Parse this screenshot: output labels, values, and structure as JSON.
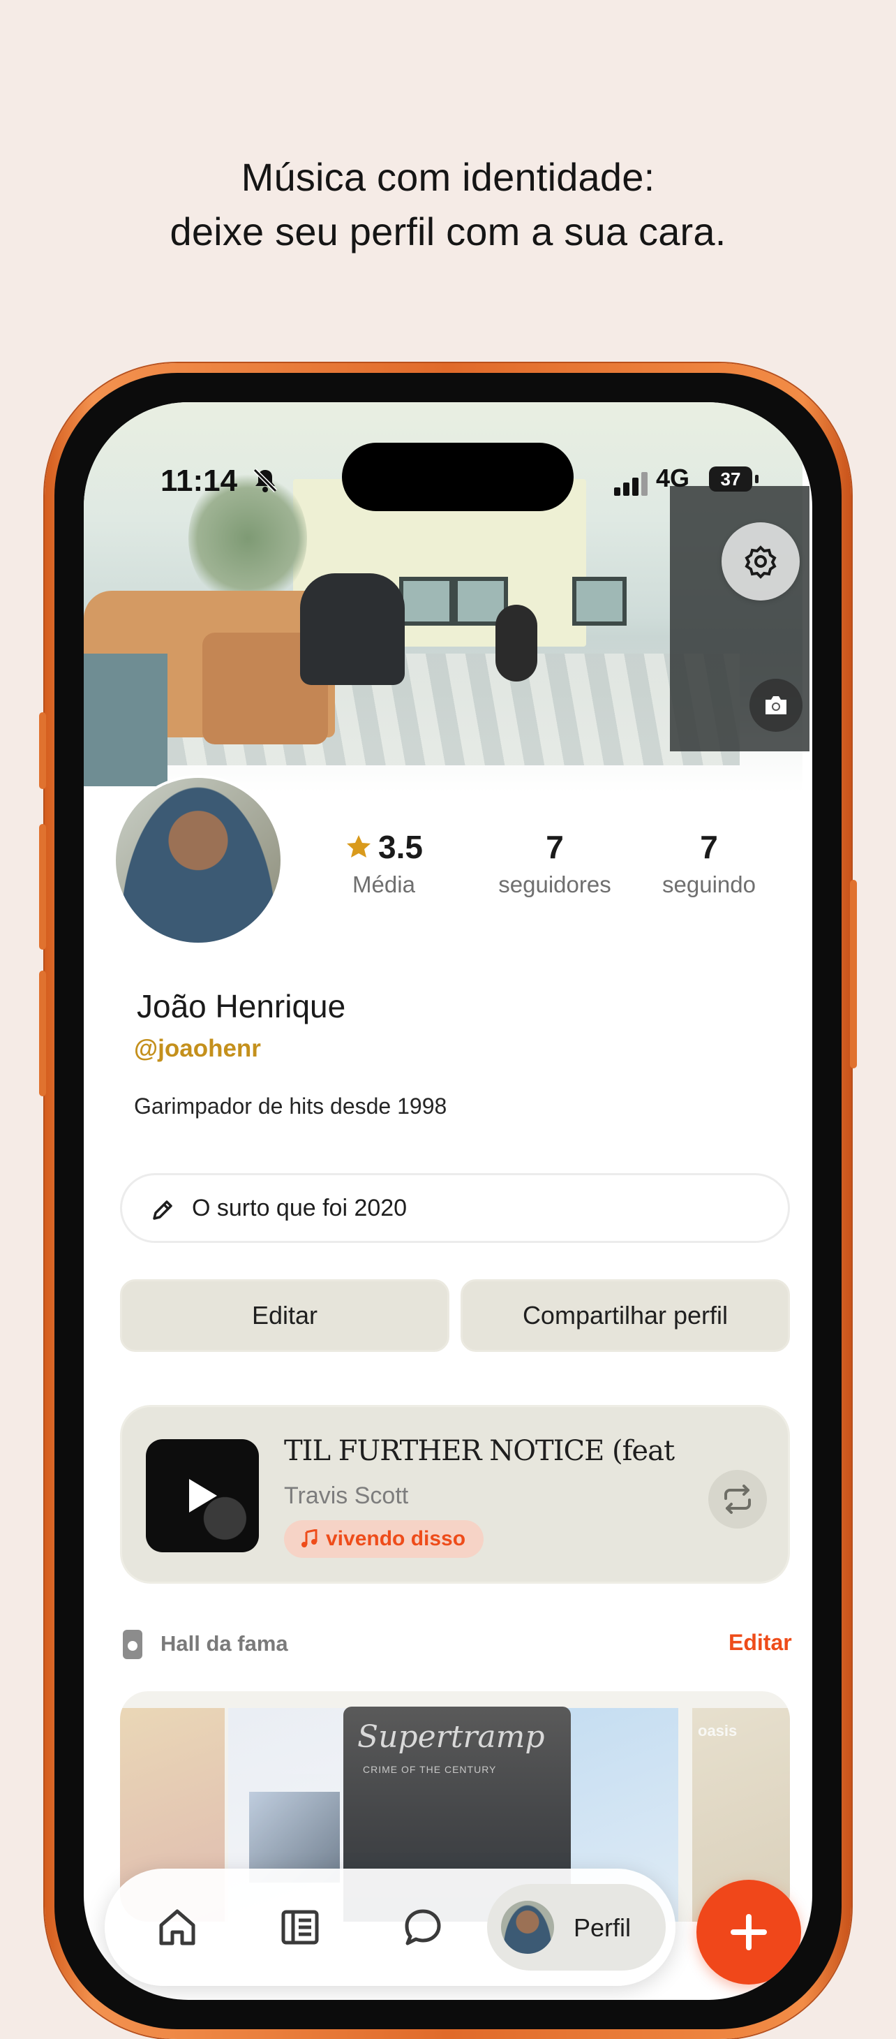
{
  "headline": {
    "line1": "Música com identidade:",
    "line2": "deixe seu perfil com a sua cara."
  },
  "status_bar": {
    "time": "11:14",
    "network": "4G",
    "battery": "37"
  },
  "profile": {
    "rating": "3.5",
    "rating_label": "Média",
    "followers": "7",
    "followers_label": "seguidores",
    "following": "7",
    "following_label": "seguindo",
    "name": "João Henrique",
    "handle": "@joaohenr",
    "bio": "Garimpador de hits desde 1998",
    "status_text": "O surto que foi 2020"
  },
  "actions": {
    "edit_label": "Editar",
    "share_label": "Compartilhar perfil"
  },
  "now_playing": {
    "title": "TIL FURTHER NOTICE (feat. Ja...",
    "artist": "Travis Scott",
    "badge": "vivendo disso"
  },
  "hall_of_fame": {
    "label": "Hall da fama",
    "edit_label": "Editar",
    "albums": [
      {
        "brand": "Supertramp",
        "subtitle": "CRIME OF THE CENTURY"
      },
      {
        "brand": "oasis"
      }
    ]
  },
  "tabbar": {
    "profile_label": "Perfil"
  },
  "colors": {
    "accent": "#ee4c1a",
    "handle": "#c4901c",
    "star": "#d99a1c",
    "background": "#f5ebe6",
    "phone_frame": "#e06a2a"
  },
  "icons": [
    "bell-slash-icon",
    "signal-icon",
    "gear-icon",
    "camera-icon",
    "star-icon",
    "pencil-icon",
    "play-icon",
    "music-note-icon",
    "repeat-icon",
    "ipod-icon",
    "home-icon",
    "feed-icon",
    "chat-icon",
    "plus-icon"
  ]
}
